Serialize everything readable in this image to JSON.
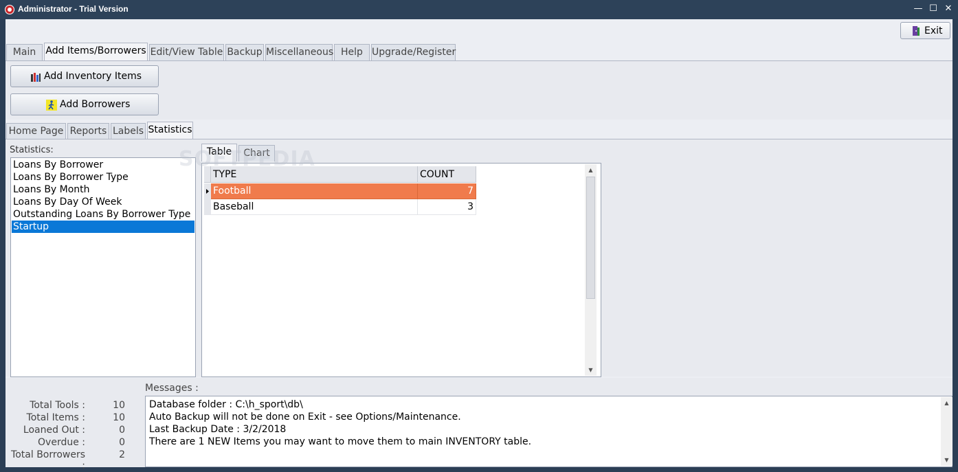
{
  "window": {
    "title": "Administrator - Trial Version",
    "minimize": "—",
    "maximize": "☐",
    "close": "✕"
  },
  "toolbar": {
    "exit_label": "Exit"
  },
  "main_tabs": [
    {
      "label": "Main"
    },
    {
      "label": "Add Items/Borrowers"
    },
    {
      "label": "Edit/View Table"
    },
    {
      "label": "Backup"
    },
    {
      "label": "Miscellaneous"
    },
    {
      "label": "Help"
    },
    {
      "label": "Upgrade/Register"
    }
  ],
  "actions": {
    "add_inventory": "Add Inventory Items",
    "add_borrowers": "Add Borrowers"
  },
  "sub_tabs": [
    {
      "label": "Home Page"
    },
    {
      "label": "Reports"
    },
    {
      "label": "Labels"
    },
    {
      "label": "Statistics"
    }
  ],
  "statistics": {
    "label": "Statistics:",
    "items": [
      "Loans By Borrower",
      "Loans By Borrower Type",
      "Loans By Month",
      "Loans By Day Of Week",
      "Outstanding Loans By Borrower Type",
      "Startup"
    ],
    "selected": "Startup"
  },
  "view_tabs": [
    {
      "label": "Table"
    },
    {
      "label": "Chart"
    }
  ],
  "grid": {
    "columns": [
      "TYPE",
      "COUNT"
    ],
    "rows": [
      {
        "type": "Football",
        "count": "7"
      },
      {
        "type": "Baseball",
        "count": "3"
      }
    ]
  },
  "messages": {
    "label": "Messages :",
    "lines": [
      "Database folder : C:\\h_sport\\db\\",
      "Auto Backup will not be done on Exit - see Options/Maintenance.",
      "Last Backup Date : 3/2/2018",
      "There are 1 NEW Items you may want to move them to main INVENTORY table."
    ]
  },
  "summary": [
    {
      "label": "Total Tools :",
      "value": "10"
    },
    {
      "label": "Total Items :",
      "value": "10"
    },
    {
      "label": "Loaned Out :",
      "value": "0"
    },
    {
      "label": "Overdue :",
      "value": "0"
    },
    {
      "label": "Total Borrowers :",
      "value": "2"
    }
  ],
  "watermark": "SOFTPEDIA",
  "colors": {
    "selection": "#0a78d7",
    "highlight_row": "#f07b4c",
    "title_bar": "#2d4259"
  }
}
